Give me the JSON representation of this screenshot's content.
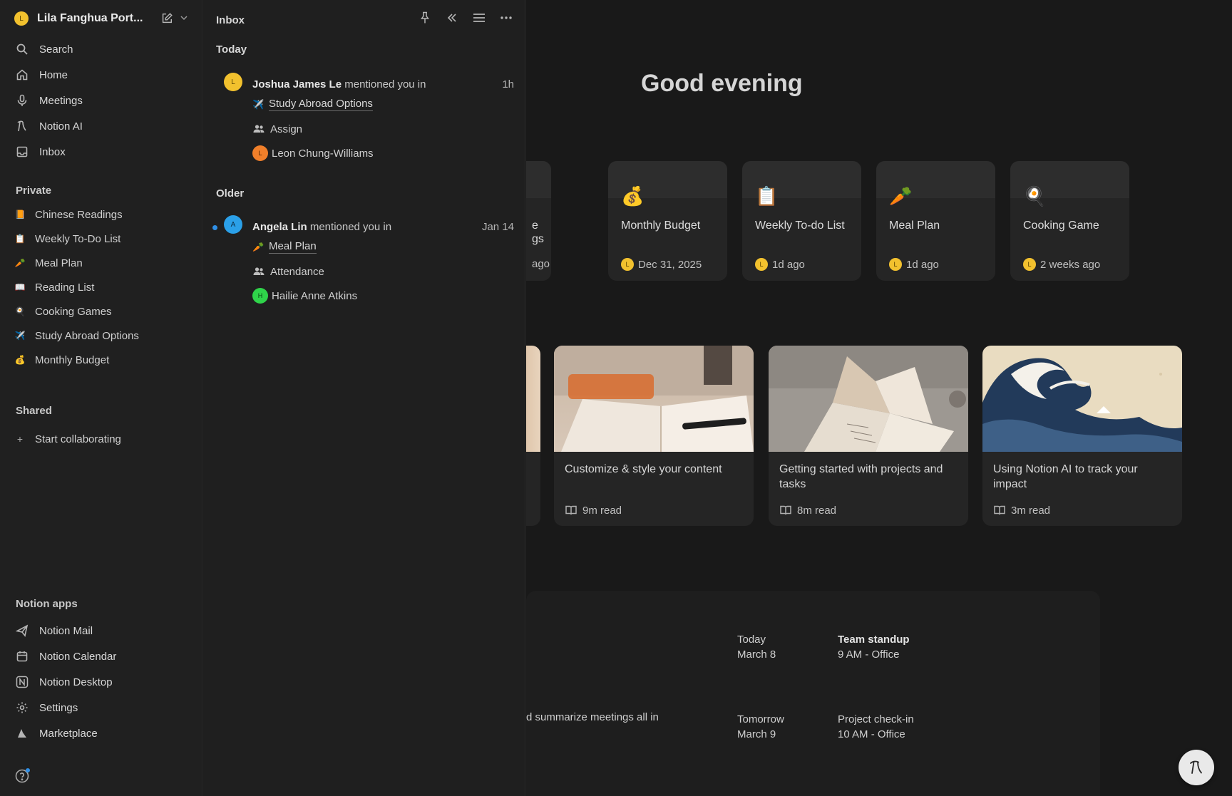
{
  "workspace": {
    "name": "Lila Fanghua Port...",
    "avatar_letter": "L"
  },
  "nav": [
    {
      "label": "Search",
      "icon": "search-icon"
    },
    {
      "label": "Home",
      "icon": "home-icon"
    },
    {
      "label": "Meetings",
      "icon": "microphone-icon"
    },
    {
      "label": "Notion AI",
      "icon": "notion-ai-icon"
    },
    {
      "label": "Inbox",
      "icon": "inbox-icon"
    }
  ],
  "private": {
    "heading": "Private",
    "pages": [
      {
        "label": "Chinese Readings",
        "emoji": "📙"
      },
      {
        "label": "Weekly To-Do List",
        "emoji": "📋"
      },
      {
        "label": "Meal Plan",
        "emoji": "🥕"
      },
      {
        "label": "Reading List",
        "emoji": "📖"
      },
      {
        "label": "Cooking Games",
        "emoji": "🍳"
      },
      {
        "label": "Study Abroad Options",
        "emoji": "✈️"
      },
      {
        "label": "Monthly Budget",
        "emoji": "💰"
      }
    ]
  },
  "shared": {
    "heading": "Shared",
    "action": "Start collaborating",
    "action_glyph": "+"
  },
  "apps": {
    "heading": "Notion apps",
    "items": [
      {
        "label": "Notion Mail",
        "icon": "send-icon"
      },
      {
        "label": "Notion Calendar",
        "icon": "calendar-icon"
      },
      {
        "label": "Notion Desktop",
        "icon": "notion-logo-icon"
      },
      {
        "label": "Settings",
        "icon": "gear-icon"
      },
      {
        "label": "Marketplace",
        "icon": "marketplace-icon"
      }
    ]
  },
  "inbox": {
    "title": "Inbox",
    "groups": {
      "today": "Today",
      "older": "Older"
    },
    "notifications": [
      {
        "author": "Joshua James Le",
        "avatar_letter": "L",
        "avatar_color": "#f2c12e",
        "action": "mentioned you in",
        "time": "1h",
        "page": {
          "emoji": "✈️",
          "title": "Study Abroad Options"
        },
        "property": "Assign",
        "person": {
          "name": "Leon Chung-Williams",
          "letter": "L",
          "color": "#f07f2a"
        }
      },
      {
        "author": "Angela Lin",
        "avatar_letter": "A",
        "avatar_color": "#2ba0e8",
        "action": "mentioned you in",
        "time": "Jan 14",
        "unread": true,
        "page": {
          "emoji": "🥕",
          "title": "Meal Plan"
        },
        "property": "Attendance",
        "person": {
          "name": "Hailie Anne Atkins",
          "letter": "H",
          "color": "#2fd44a"
        }
      }
    ]
  },
  "main": {
    "greeting": "Good evening",
    "recent": [
      {
        "title": "e\ngs",
        "meta": "ago",
        "emoji": "",
        "partial": true
      },
      {
        "title": "Monthly Budget",
        "emoji": "💰",
        "meta": "Dec 31, 2025"
      },
      {
        "title": "Weekly To-do List",
        "emoji": "📋",
        "meta": "1d ago"
      },
      {
        "title": "Meal Plan",
        "emoji": "🥕",
        "meta": "1d ago"
      },
      {
        "title": "Cooking Game",
        "emoji": "🍳",
        "meta": "2 weeks ago"
      }
    ],
    "learn": [
      {
        "title": "Customize & style your content",
        "read": "9m read",
        "image": "notebook-photo"
      },
      {
        "title": "Getting started with projects and tasks",
        "read": "8m read",
        "image": "open-book-photo"
      },
      {
        "title": "Using Notion AI to track your impact",
        "read": "3m read",
        "image": "great-wave-painting"
      }
    ],
    "calendar": {
      "partial_text": "d summarize meetings all in",
      "events": [
        {
          "day": "Today",
          "date": "March 8",
          "title": "Team standup",
          "detail": "9 AM - Office",
          "bold": true
        },
        {
          "day": "Tomorrow",
          "date": "March 9",
          "title": "Project check-in",
          "detail": "10 AM - Office",
          "bold": false
        }
      ]
    }
  },
  "colors": {
    "accent": "#2f8fe6",
    "workspace_avatar": "#f2c12e"
  }
}
